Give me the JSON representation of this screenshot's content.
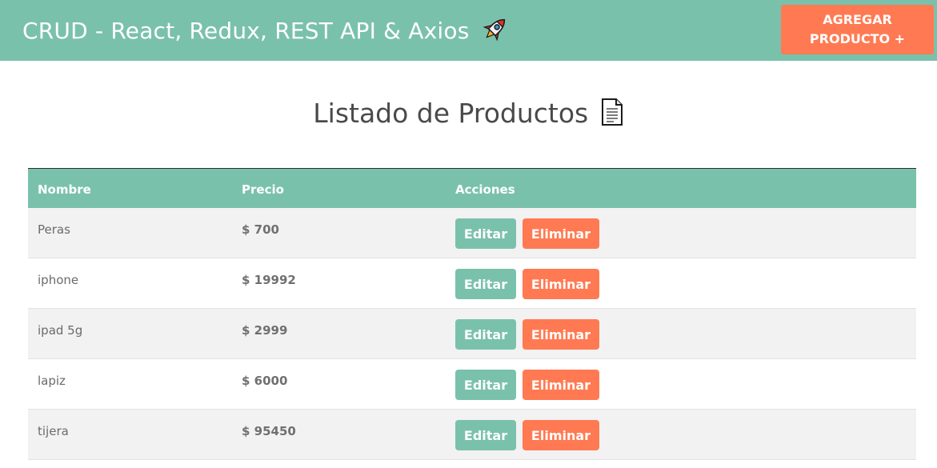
{
  "header": {
    "title": "CRUD - React, Redux, REST API & Axios",
    "title_icon": "rocket-icon",
    "add_button_line1": "AGREGAR",
    "add_button_line2": "PRODUCTO +"
  },
  "main": {
    "title": "Listado de Productos",
    "title_icon": "document-icon"
  },
  "table": {
    "headers": {
      "nombre": "Nombre",
      "precio": "Precio",
      "acciones": "Acciones"
    },
    "rows": [
      {
        "name": "Peras",
        "price": "$ 700",
        "edit_label": "Editar",
        "delete_label": "Eliminar"
      },
      {
        "name": "iphone",
        "price": "$ 19992",
        "edit_label": "Editar",
        "delete_label": "Eliminar"
      },
      {
        "name": "ipad 5g",
        "price": "$ 2999",
        "edit_label": "Editar",
        "delete_label": "Eliminar"
      },
      {
        "name": "lapiz",
        "price": "$ 6000",
        "edit_label": "Editar",
        "delete_label": "Eliminar"
      },
      {
        "name": "tijera",
        "price": "$ 95450",
        "edit_label": "Editar",
        "delete_label": "Eliminar"
      }
    ]
  },
  "colors": {
    "primary": "#7ac1ac",
    "accent": "#ff7a52",
    "row_stripe": "#f2f2f2"
  }
}
